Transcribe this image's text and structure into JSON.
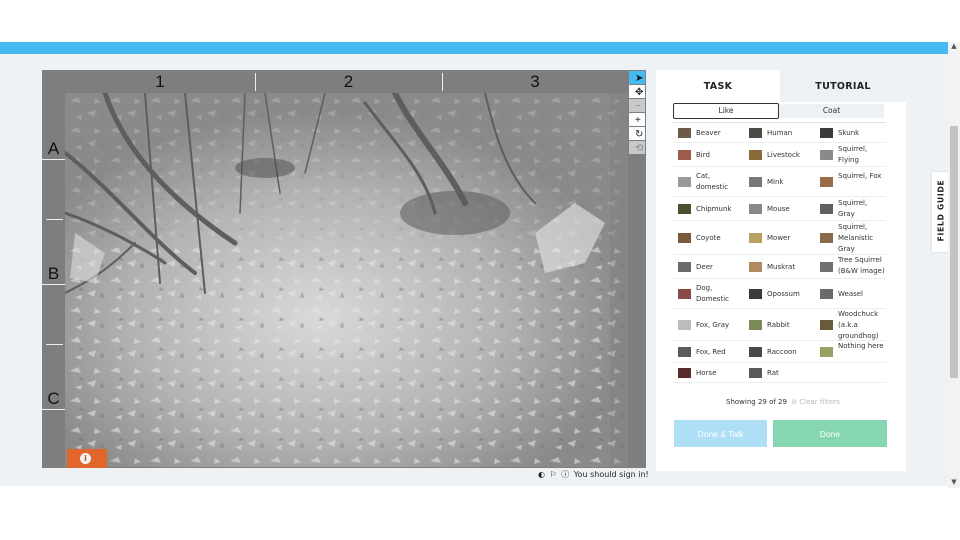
{
  "viewer": {
    "columns": [
      "1",
      "2",
      "3"
    ],
    "rows": [
      "A",
      "B",
      "C"
    ],
    "badge_glyph": "i"
  },
  "tools": [
    {
      "name": "pointer-tool",
      "glyph": "➤"
    },
    {
      "name": "move-tool",
      "glyph": "✥"
    },
    {
      "name": "zoom-out-tool",
      "glyph": "−"
    },
    {
      "name": "zoom-in-tool",
      "glyph": "+"
    },
    {
      "name": "rotate-tool",
      "glyph": "↻"
    },
    {
      "name": "reset-tool",
      "glyph": "⟲"
    }
  ],
  "meta": {
    "signin_text": "You should sign in!"
  },
  "panel": {
    "tabs": {
      "task": "TASK",
      "tutorial": "TUTORIAL"
    },
    "filters": {
      "like": "Like",
      "coat": "Coat"
    },
    "choices": [
      [
        "Beaver",
        "Human",
        "Skunk"
      ],
      [
        "Bird",
        "Livestock",
        "Squirrel, Flying"
      ],
      [
        "Cat, domestic",
        "Mink",
        "Squirrel, Fox"
      ],
      [
        "Chipmunk",
        "Mouse",
        "Squirrel, Gray"
      ],
      [
        "Coyote",
        "Mower",
        "Squirrel, Melanistic Gray"
      ],
      [
        "Deer",
        "Muskrat",
        "Tree Squirrel (B&W image)"
      ],
      [
        "Dog, Domestic",
        "Opossum",
        "Weasel"
      ],
      [
        "Fox, Gray",
        "Rabbit",
        "Woodchuck (a.k.a groundhog)"
      ],
      [
        "Fox, Red",
        "Raccoon",
        "Nothing here"
      ],
      [
        "Horse",
        "Rat",
        ""
      ]
    ],
    "showing": "Showing 29 of 29",
    "clear_filters": "Clear filters",
    "done_talk": "Done & Talk",
    "done": "Done"
  },
  "field_guide": "FIELD GUIDE",
  "colors": {
    "accent": "#43bbf0",
    "done": "#86d6b1",
    "done_talk": "#aedff6",
    "badge": "#e0662b"
  }
}
